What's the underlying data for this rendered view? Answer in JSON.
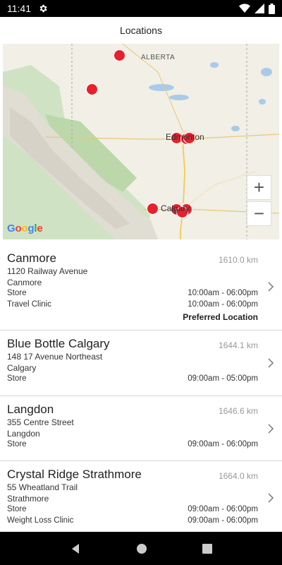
{
  "status_bar": {
    "time": "11:41"
  },
  "app_bar": {
    "title": "Locations"
  },
  "map": {
    "labels": {
      "province": "ALBERTA",
      "city1": "Edmonton",
      "city2": "Calgary"
    },
    "google_logo": {
      "g1": "G",
      "o1": "o",
      "o2": "o",
      "g2": "g",
      "l": "l",
      "e": "e"
    },
    "zoom_in": "+",
    "zoom_out": "−",
    "marker_color": "#e8202e"
  },
  "locations": [
    {
      "name": "Canmore",
      "distance": "1610.0 km",
      "address": "1120 Railway Avenue",
      "city": "Canmore",
      "services": [
        {
          "name": "Store",
          "hours": "10:00am - 06:00pm"
        },
        {
          "name": "Travel Clinic",
          "hours": "10:00am - 06:00pm"
        }
      ],
      "preferred": "Preferred Location"
    },
    {
      "name": "Blue Bottle Calgary",
      "distance": "1644.1 km",
      "address": "148 17 Avenue Northeast",
      "city": "Calgary",
      "services": [
        {
          "name": "Store",
          "hours": "09:00am - 05:00pm"
        }
      ]
    },
    {
      "name": "Langdon",
      "distance": "1646.6 km",
      "address": "355 Centre Street",
      "city": "Langdon",
      "services": [
        {
          "name": "Store",
          "hours": "09:00am - 06:00pm"
        }
      ]
    },
    {
      "name": "Crystal Ridge Strathmore",
      "distance": "1664.0 km",
      "address": "55 Wheatland Trail",
      "city": "Strathmore",
      "services": [
        {
          "name": "Store",
          "hours": "09:00am - 06:00pm"
        },
        {
          "name": "Weight Loss Clinic",
          "hours": "09:00am - 06:00pm"
        }
      ]
    }
  ]
}
